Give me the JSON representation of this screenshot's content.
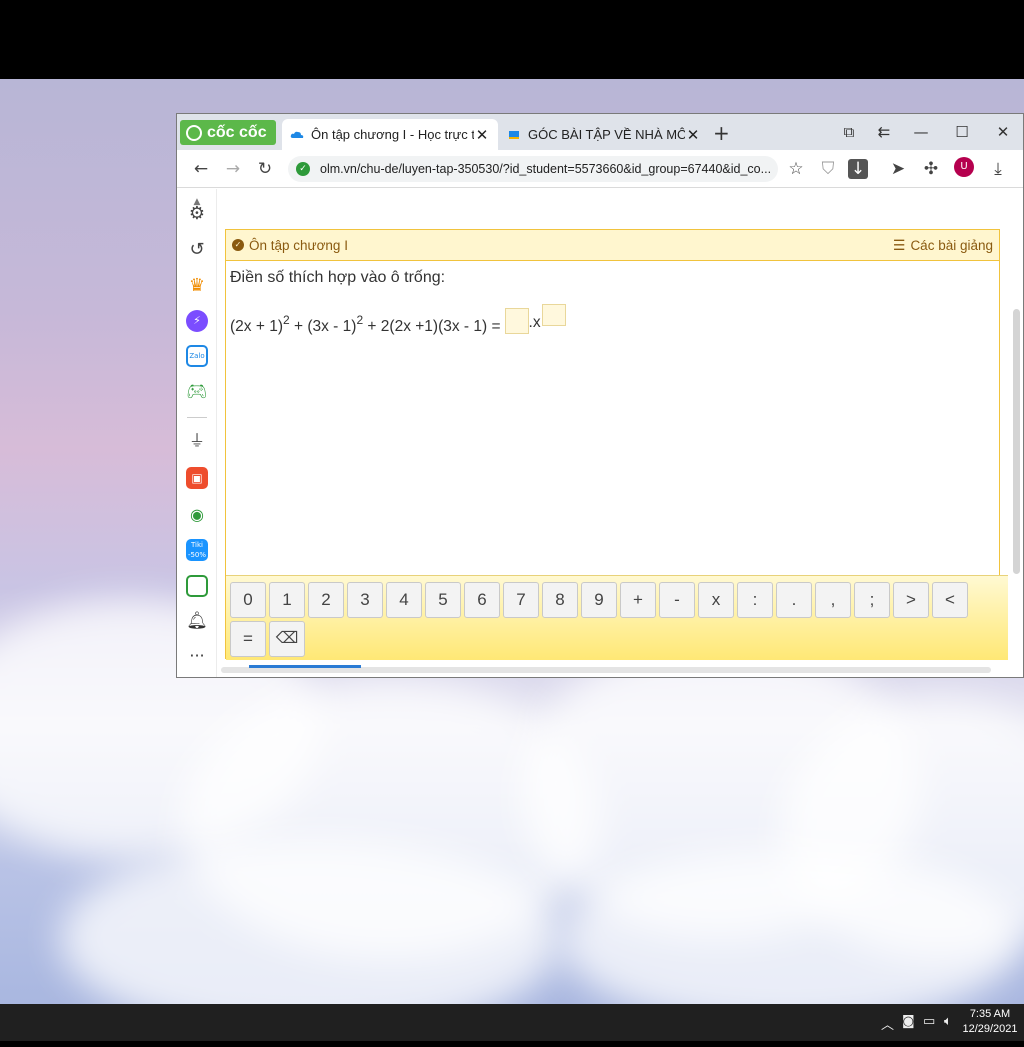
{
  "browser": {
    "brand": "cốc cốc",
    "tabs": [
      {
        "title": "Ôn tập chương I - Học trực tuyến",
        "active": true
      },
      {
        "title": "GÓC BÀI TẬP VỀ NHÀ MÔN",
        "active": false
      }
    ],
    "url": "olm.vn/chu-de/luyen-tap-350530/?id_student=5573660&id_group=67440&id_co...",
    "avatar_letter": "U"
  },
  "lesson": {
    "header_title": "Ôn tập chương I",
    "header_link": "Các bài giảng",
    "instruction": "Điền số thích hợp vào ô trống:",
    "equation": {
      "part1": "(2x + 1)",
      "exp1": "2",
      "part2": " + (3x - 1)",
      "exp2": "2",
      "part3": " + 2(2x +1)(3x - 1) =",
      "mid": ".x"
    }
  },
  "keypad": {
    "row1": [
      "0",
      "1",
      "2",
      "3",
      "4",
      "5",
      "6",
      "7",
      "8",
      "9",
      "+",
      "-",
      "x",
      ":",
      ".",
      ",",
      ";",
      ">",
      "<"
    ],
    "row2": [
      "="
    ],
    "backspace": "⌫"
  },
  "taskbar": {
    "time": "7:35 AM",
    "date": "12/29/2021"
  }
}
